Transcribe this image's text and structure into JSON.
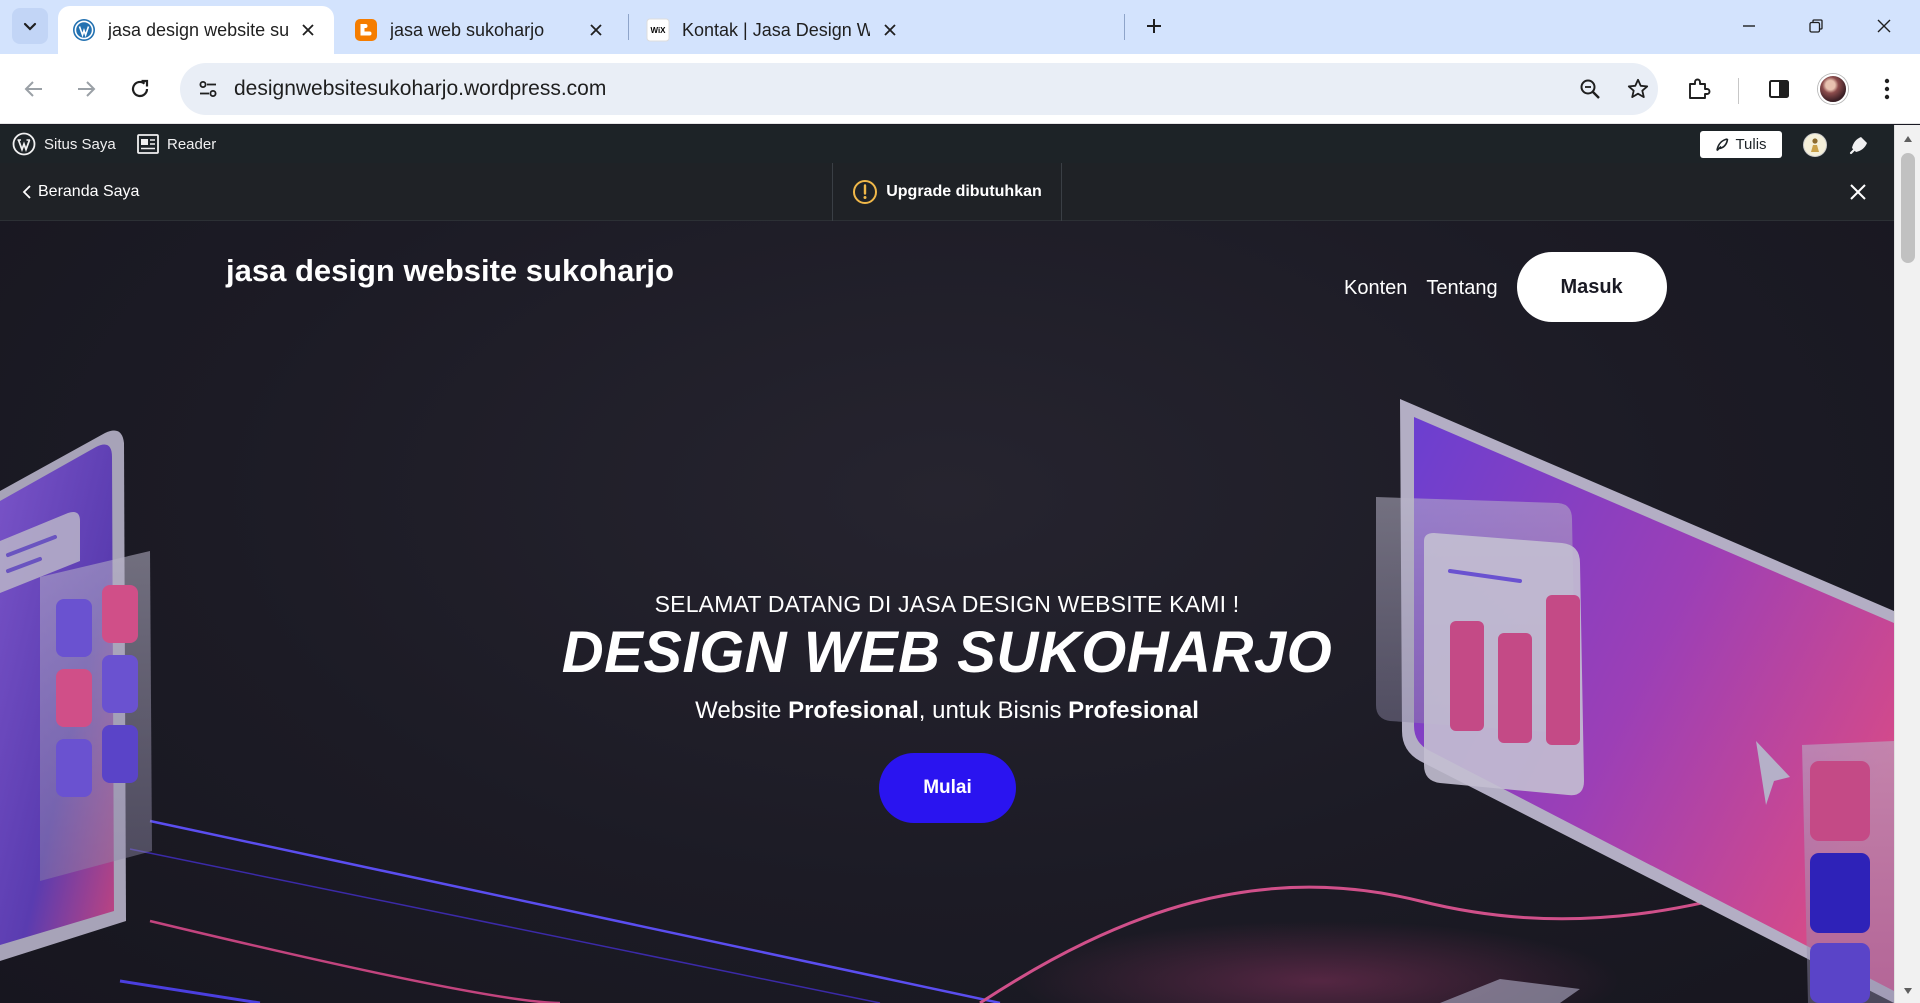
{
  "browser": {
    "tabs": [
      {
        "title": "jasa design website sukoharjo -",
        "active": true,
        "favicon": "wordpress-icon"
      },
      {
        "title": "jasa web sukoharjo",
        "active": false,
        "favicon": "blogger-icon"
      },
      {
        "title": "Kontak | Jasa Design Web Suko",
        "active": false,
        "favicon": "wix-icon"
      }
    ],
    "url": "designwebsitesukoharjo.wordpress.com"
  },
  "adminbar": {
    "my_site": "Situs Saya",
    "reader": "Reader",
    "write": "Tulis"
  },
  "upgradebar": {
    "back": "Beranda Saya",
    "upgrade": "Upgrade dibutuhkan"
  },
  "site": {
    "title": "jasa design website sukoharjo",
    "nav": [
      "Konten",
      "Tentang"
    ],
    "login": "Masuk"
  },
  "hero": {
    "eyebrow": "SELAMAT DATANG DI JASA DESIGN WEBSITE KAMI !",
    "title": "DESIGN WEB SUKOHARJO",
    "sub_1": "Website ",
    "sub_2": "Profesional",
    "sub_3": ", untuk Bisnis ",
    "sub_4": "Profesional",
    "cta": "Mulai"
  },
  "colors": {
    "accent_button": "#2a14f0",
    "tabstrip": "#d3e3fd",
    "adminbar": "#1d2327"
  }
}
